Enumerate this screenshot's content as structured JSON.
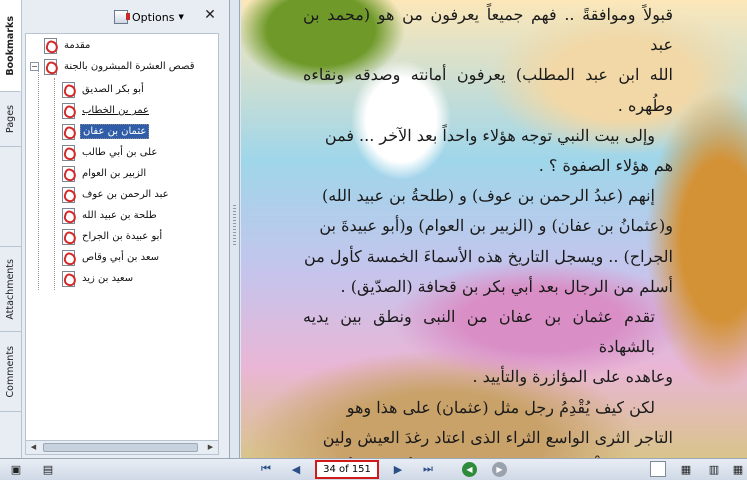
{
  "tabs": [
    "Bookmarks",
    "Pages",
    "Attachments",
    "Comments"
  ],
  "panel": {
    "options_label": "Options",
    "close_label": "✕"
  },
  "bookmarks": [
    {
      "label": "مقدمة",
      "level": 0
    },
    {
      "label": "قصص العشرة المبشرون بالجنة",
      "level": 0,
      "expanded": true
    },
    {
      "label": "أبو بكر الصديق",
      "level": 1
    },
    {
      "label": "عمر بن الخطاب",
      "level": 1
    },
    {
      "label": "عثمان بن عفان",
      "level": 1,
      "selected": true
    },
    {
      "label": "على بن أبي طالب",
      "level": 1
    },
    {
      "label": "الزبير بن العوام",
      "level": 1
    },
    {
      "label": "عبد الرحمن بن عوف",
      "level": 1
    },
    {
      "label": "طلحة بن عبيد الله",
      "level": 1
    },
    {
      "label": "أبو عبيدة بن الجراح",
      "level": 1
    },
    {
      "label": "سعد بن أبي وقاص",
      "level": 1
    },
    {
      "label": "سعيد بن زيد",
      "level": 1
    }
  ],
  "document": {
    "lines": [
      "قبولاً وموافقةً .. فهم جميعاً يعرفون من هو (محمد بن عبد",
      "الله ابن عبد المطلب) يعرفون أمانته وصدقه ونقاءه وطُهره .",
      "وإلى بيت النبي توجه هؤلاء واحداً بعد الآخر ... فمن",
      "هم هؤلاء الصفوة ؟ .",
      "إنهم (عبدُ الرحمن بن عوف) و (طلحةُ بن عبيد الله)",
      "و(عثمانُ بن عفان) و (الزبير بن العوام) و(أبو عبيدةَ بن",
      "الجراح) .. ويسجل التاريخ هذه الأسماءَ الخمسة كأول من",
      "أسلم من الرجال بعد أبي بكر بن قحافة (الصدّيق) .",
      "تقدم عثمان بن عفان من النبى ونطق بين يديه بالشهادة",
      "وعاهده على المؤازرة والتأييد .",
      "لكن كيف يُقْدِمُ رجل مثل (عثمان) على هذا وهو",
      "التاجر الثرى الواسع الثراء الذى اعتاد رغدَ العيش ولين",
      "الفراش وحُلْو الطعام .. كيف يقدم على أمر يعلم أنه يؤثر"
    ]
  },
  "toolbar": {
    "page_display": "34 of 151"
  },
  "colors": {
    "selection": "#2f5da8",
    "page_box_border": "#d11a1a",
    "panel_bg": "#e8edf3"
  }
}
